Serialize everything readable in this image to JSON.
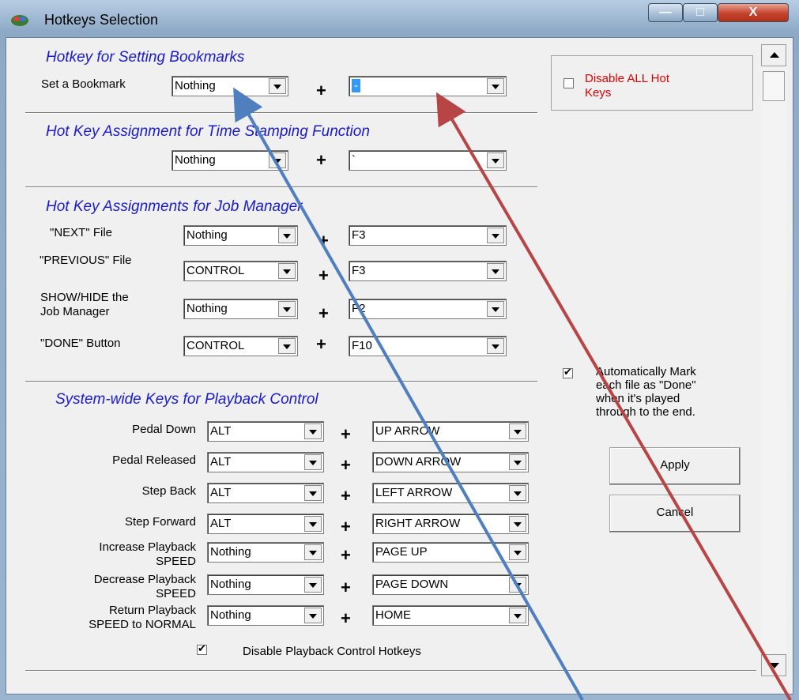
{
  "window": {
    "title": "Hotkeys Selection",
    "caption": {
      "minimize": "—",
      "maximize": "□",
      "close": "X"
    }
  },
  "bookmarks": {
    "title": "Hotkey for Setting Bookmarks",
    "label": "Set a Bookmark",
    "modifier": "Nothing",
    "key": "-"
  },
  "timestamp": {
    "title": "Hot Key Assignment for Time Stamping Function",
    "modifier": "Nothing",
    "key": "`"
  },
  "job_manager": {
    "title": "Hot Key Assignments for Job Manager",
    "rows": [
      {
        "label": "\"NEXT\" File",
        "modifier": "Nothing",
        "key": "F3"
      },
      {
        "label": "\"PREVIOUS\" File",
        "modifier": "CONTROL",
        "key": "F3"
      },
      {
        "label1": "SHOW/HIDE the",
        "label2": "Job Manager",
        "modifier": "Nothing",
        "key": "F2"
      },
      {
        "label": "\"DONE\" Button",
        "modifier": "CONTROL",
        "key": "F10"
      }
    ]
  },
  "playback": {
    "title": "System-wide Keys for Playback Control",
    "rows": [
      {
        "label1": "Pedal Down",
        "modifier": "ALT",
        "key": "UP ARROW"
      },
      {
        "label1": "Pedal Released",
        "modifier": "ALT",
        "key": "DOWN ARROW"
      },
      {
        "label1": "Step Back",
        "modifier": "ALT",
        "key": "LEFT ARROW"
      },
      {
        "label1": "Step Forward",
        "modifier": "ALT",
        "key": "RIGHT ARROW"
      },
      {
        "label1": "Increase Playback",
        "label2": "SPEED",
        "modifier": "Nothing",
        "key": "PAGE UP"
      },
      {
        "label1": "Decrease Playback",
        "label2": "SPEED",
        "modifier": "Nothing",
        "key": "PAGE DOWN"
      },
      {
        "label1": "Return Playback",
        "label2": "SPEED to NORMAL",
        "modifier": "Nothing",
        "key": "HOME"
      }
    ],
    "disable_label": "Disable Playback Control Hotkeys",
    "disable_checked": true
  },
  "plus": "+",
  "disable_all": {
    "line1": "Disable ALL Hot",
    "line2": "Keys",
    "checked": false,
    "color": "#e00000"
  },
  "auto_mark": {
    "line1": "Automatically Mark",
    "line2": "each file as \"Done\"",
    "line3": "when it's played",
    "line4": "through to the end.",
    "checked": true
  },
  "buttons": {
    "apply": "Apply",
    "cancel": "Cancel"
  },
  "check_mark": "✔",
  "accent": "#1a1ad0",
  "annotation_colors": {
    "blue": "#4f7fbf",
    "red": "#b84545"
  }
}
